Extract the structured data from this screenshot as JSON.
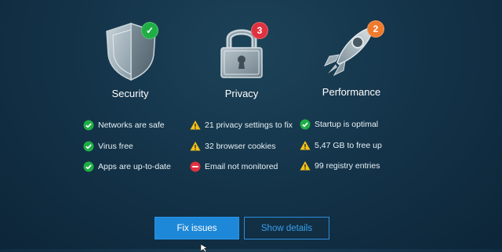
{
  "categories": [
    {
      "key": "security",
      "title": "Security",
      "icon": "shield-icon",
      "badge": {
        "type": "check",
        "text": "✓",
        "color": "#1fae45"
      },
      "items": [
        {
          "status": "ok",
          "text": "Networks are safe"
        },
        {
          "status": "ok",
          "text": "Virus free"
        },
        {
          "status": "ok",
          "text": "Apps are up-to-date"
        }
      ]
    },
    {
      "key": "privacy",
      "title": "Privacy",
      "icon": "padlock-icon",
      "badge": {
        "type": "count",
        "text": "3",
        "color": "#e0313f"
      },
      "items": [
        {
          "status": "warning",
          "text": "21 privacy settings to fix"
        },
        {
          "status": "warning",
          "text": "32 browser cookies"
        },
        {
          "status": "blocked",
          "text": "Email not monitored"
        }
      ]
    },
    {
      "key": "performance",
      "title": "Performance",
      "icon": "rocket-icon",
      "badge": {
        "type": "count",
        "text": "2",
        "color": "#f07a2c"
      },
      "items": [
        {
          "status": "ok",
          "text": "Startup is optimal"
        },
        {
          "status": "warning",
          "text": "5,47 GB to free up"
        },
        {
          "status": "warning",
          "text": "99 registry entries"
        }
      ]
    }
  ],
  "actions": {
    "fix_label": "Fix issues",
    "details_label": "Show details"
  },
  "colors": {
    "ok": "#1fae45",
    "warning": "#f2c21b",
    "blocked": "#e0313f",
    "accent": "#1e88d8"
  }
}
